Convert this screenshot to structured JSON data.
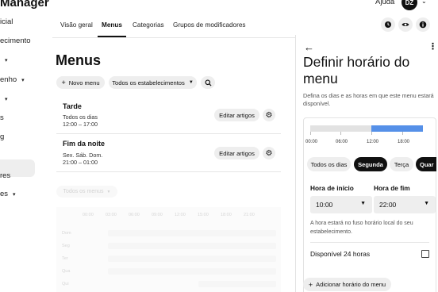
{
  "app": {
    "title": "Manager"
  },
  "header": {
    "help_label": "Ajuda",
    "avatar_initials": "DZ"
  },
  "sidebar": {
    "items": [
      {
        "label": "icial",
        "has_chevron": false
      },
      {
        "label": "ecimento",
        "has_chevron": false
      },
      {
        "label": "",
        "has_chevron": true
      },
      {
        "label": "enho",
        "has_chevron": true
      },
      {
        "label": "",
        "has_chevron": true
      },
      {
        "label": "s",
        "has_chevron": false
      },
      {
        "label": "g",
        "has_chevron": false
      },
      {
        "label": "",
        "has_chevron": false
      },
      {
        "label": "res",
        "has_chevron": false
      },
      {
        "label": "es",
        "has_chevron": true
      }
    ]
  },
  "tabs": [
    {
      "label": "Visão geral",
      "active": false
    },
    {
      "label": "Menus",
      "active": true
    },
    {
      "label": "Categorias",
      "active": false
    },
    {
      "label": "Grupos de modificadores",
      "active": false
    }
  ],
  "tab_actions": [
    {
      "icon": "clock-icon"
    },
    {
      "icon": "eye-icon"
    },
    {
      "icon": "info-icon"
    }
  ],
  "main": {
    "title": "Menus",
    "new_menu_label": "Novo menu",
    "filter_label": "Todos os estabelecimentos",
    "menus": [
      {
        "name": "Tarde",
        "days": "Todos os dias",
        "hours": "12:00 – 17:00",
        "edit_label": "Editar artigos"
      },
      {
        "name": "Fim da noite",
        "days": "Sex. Sáb. Dom.",
        "hours": "21:00 – 01:00",
        "edit_label": "Editar artigos"
      }
    ],
    "overview": {
      "filter_label": "Todos os menus",
      "hours": [
        "00:00",
        "03:00",
        "06:00",
        "09:00",
        "12:00",
        "15:00",
        "18:00",
        "21:00"
      ],
      "days": [
        "Dom",
        "Seg",
        "Ter",
        "Qua",
        "Qui"
      ]
    }
  },
  "panel": {
    "title": "Definir horário do menu",
    "description": "Defina os dias e as horas em que este menu estará disponível.",
    "timeline": {
      "labels": [
        "00:00",
        "06:00",
        "12:00",
        "18:00"
      ],
      "range_start": 12,
      "range_end": 22,
      "scale_hours": 22
    },
    "day_chips": [
      {
        "label": "Todos os dias",
        "selected": false
      },
      {
        "label": "Segunda",
        "selected": true
      },
      {
        "label": "Terça",
        "selected": false
      },
      {
        "label": "Quar",
        "selected": true
      }
    ],
    "start_label": "Hora de início",
    "start_value": "10:00",
    "end_label": "Hora de fim",
    "end_value": "22:00",
    "timezone_note": "A hora estará no fuso horário local do seu estabelecimento.",
    "available_24h_label": "Disponível 24 horas",
    "available_24h_checked": false,
    "add_hours_label": "Adicionar horário do menu"
  },
  "colors": {
    "accent": "#5590e8",
    "selected_chip": "#111111",
    "pill_bg": "#eeeeee"
  }
}
